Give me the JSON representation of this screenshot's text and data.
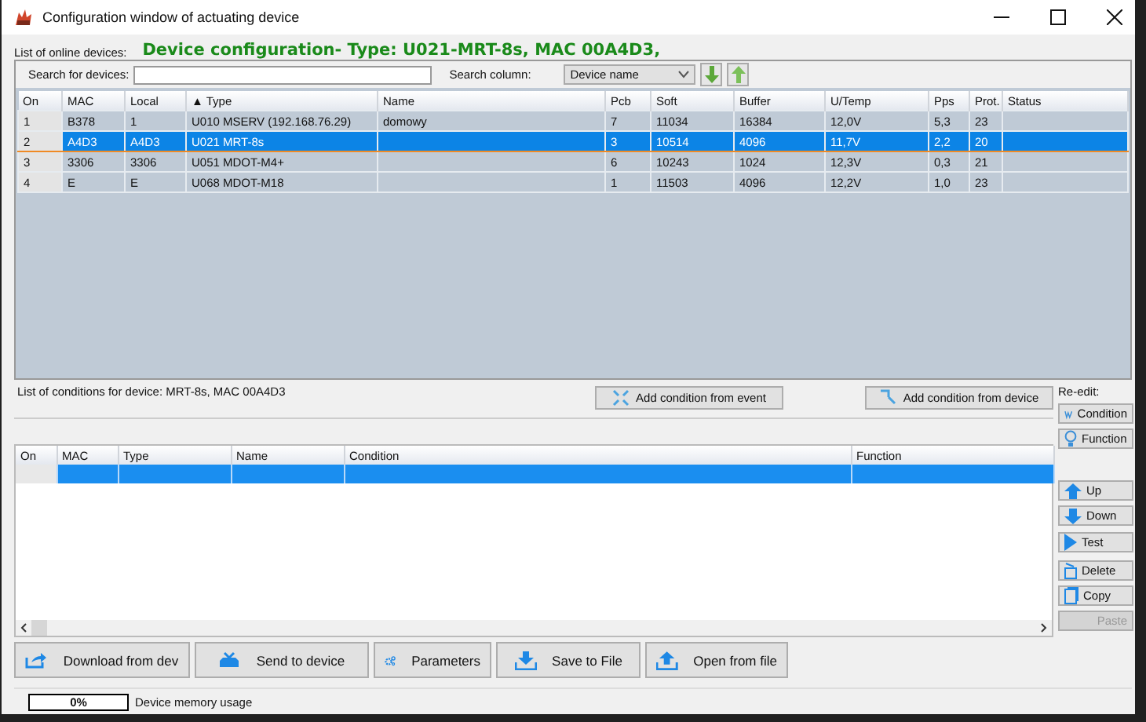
{
  "window": {
    "title": "Configuration window of actuating device"
  },
  "devices_label": "List of online devices:",
  "heading": "Device configuration- Type: U021-MRT-8s, MAC 00A4D3,",
  "search": {
    "label": "Search for devices:"
  },
  "search_column": {
    "label": "Search column:",
    "value": "Device name"
  },
  "devices": {
    "columns": [
      "On",
      "MAC",
      "Local",
      "▲ Type",
      "Name",
      "Pcb",
      "Soft",
      "Buffer",
      "U/Temp",
      "Pps",
      "Prot.",
      "Status"
    ],
    "rows": [
      {
        "cells": [
          "1",
          "B378",
          "1",
          "U010 MSERV (192.168.76.29)",
          "domowy",
          "7",
          "11034",
          "16384",
          "12,0V",
          "5,3",
          "23"
        ],
        "selected": false
      },
      {
        "cells": [
          "2",
          "A4D3",
          "A4D3",
          "U021 MRT-8s",
          "",
          "3",
          "10514",
          "4096",
          "11,7V",
          "2,2",
          "20"
        ],
        "selected": true
      },
      {
        "cells": [
          "3",
          "3306",
          "3306",
          "U051 MDOT-M4+",
          "",
          "6",
          "10243",
          "1024",
          "12,3V",
          "0,3",
          "21"
        ],
        "selected": false
      },
      {
        "cells": [
          "4",
          "E",
          "E",
          "U068 MDOT-M18",
          "",
          "1",
          "11503",
          "4096",
          "12,2V",
          "1,0",
          "23"
        ],
        "selected": false
      }
    ]
  },
  "conditions": {
    "label": "List of conditions for device: MRT-8s, MAC 00A4D3",
    "columns": [
      "On",
      "MAC",
      "Type",
      "Name",
      "Condition",
      "Function"
    ],
    "rows": [
      {
        "selected": true
      }
    ]
  },
  "condition_buttons": [
    {
      "label": "Add condition from event",
      "kind": "event"
    },
    {
      "label": "Add condition from device",
      "kind": "device"
    }
  ],
  "re_edit_label": "Re-edit:",
  "side_buttons": [
    {
      "label": "Condition",
      "kind": "condition",
      "disabled": false
    },
    {
      "label": "Function",
      "kind": "function",
      "disabled": false
    },
    {
      "label": "Up",
      "kind": "up",
      "disabled": false
    },
    {
      "label": "Down",
      "kind": "down",
      "disabled": false
    },
    {
      "label": "Test",
      "kind": "test",
      "disabled": false
    },
    {
      "label": "Delete",
      "kind": "delete",
      "disabled": false
    },
    {
      "label": "Copy",
      "kind": "copy",
      "disabled": false
    },
    {
      "label": "Paste",
      "kind": "paste",
      "disabled": true
    }
  ],
  "actions": [
    {
      "label": "Download from dev",
      "kind": "download"
    },
    {
      "label": "Send to device",
      "kind": "send"
    },
    {
      "label": "Parameters",
      "kind": "parameters"
    },
    {
      "label": "Save to File",
      "kind": "save"
    },
    {
      "label": "Open from file",
      "kind": "open"
    }
  ],
  "status_bar": {
    "progress": "0%",
    "level": 0,
    "label": "Device memory usage"
  }
}
